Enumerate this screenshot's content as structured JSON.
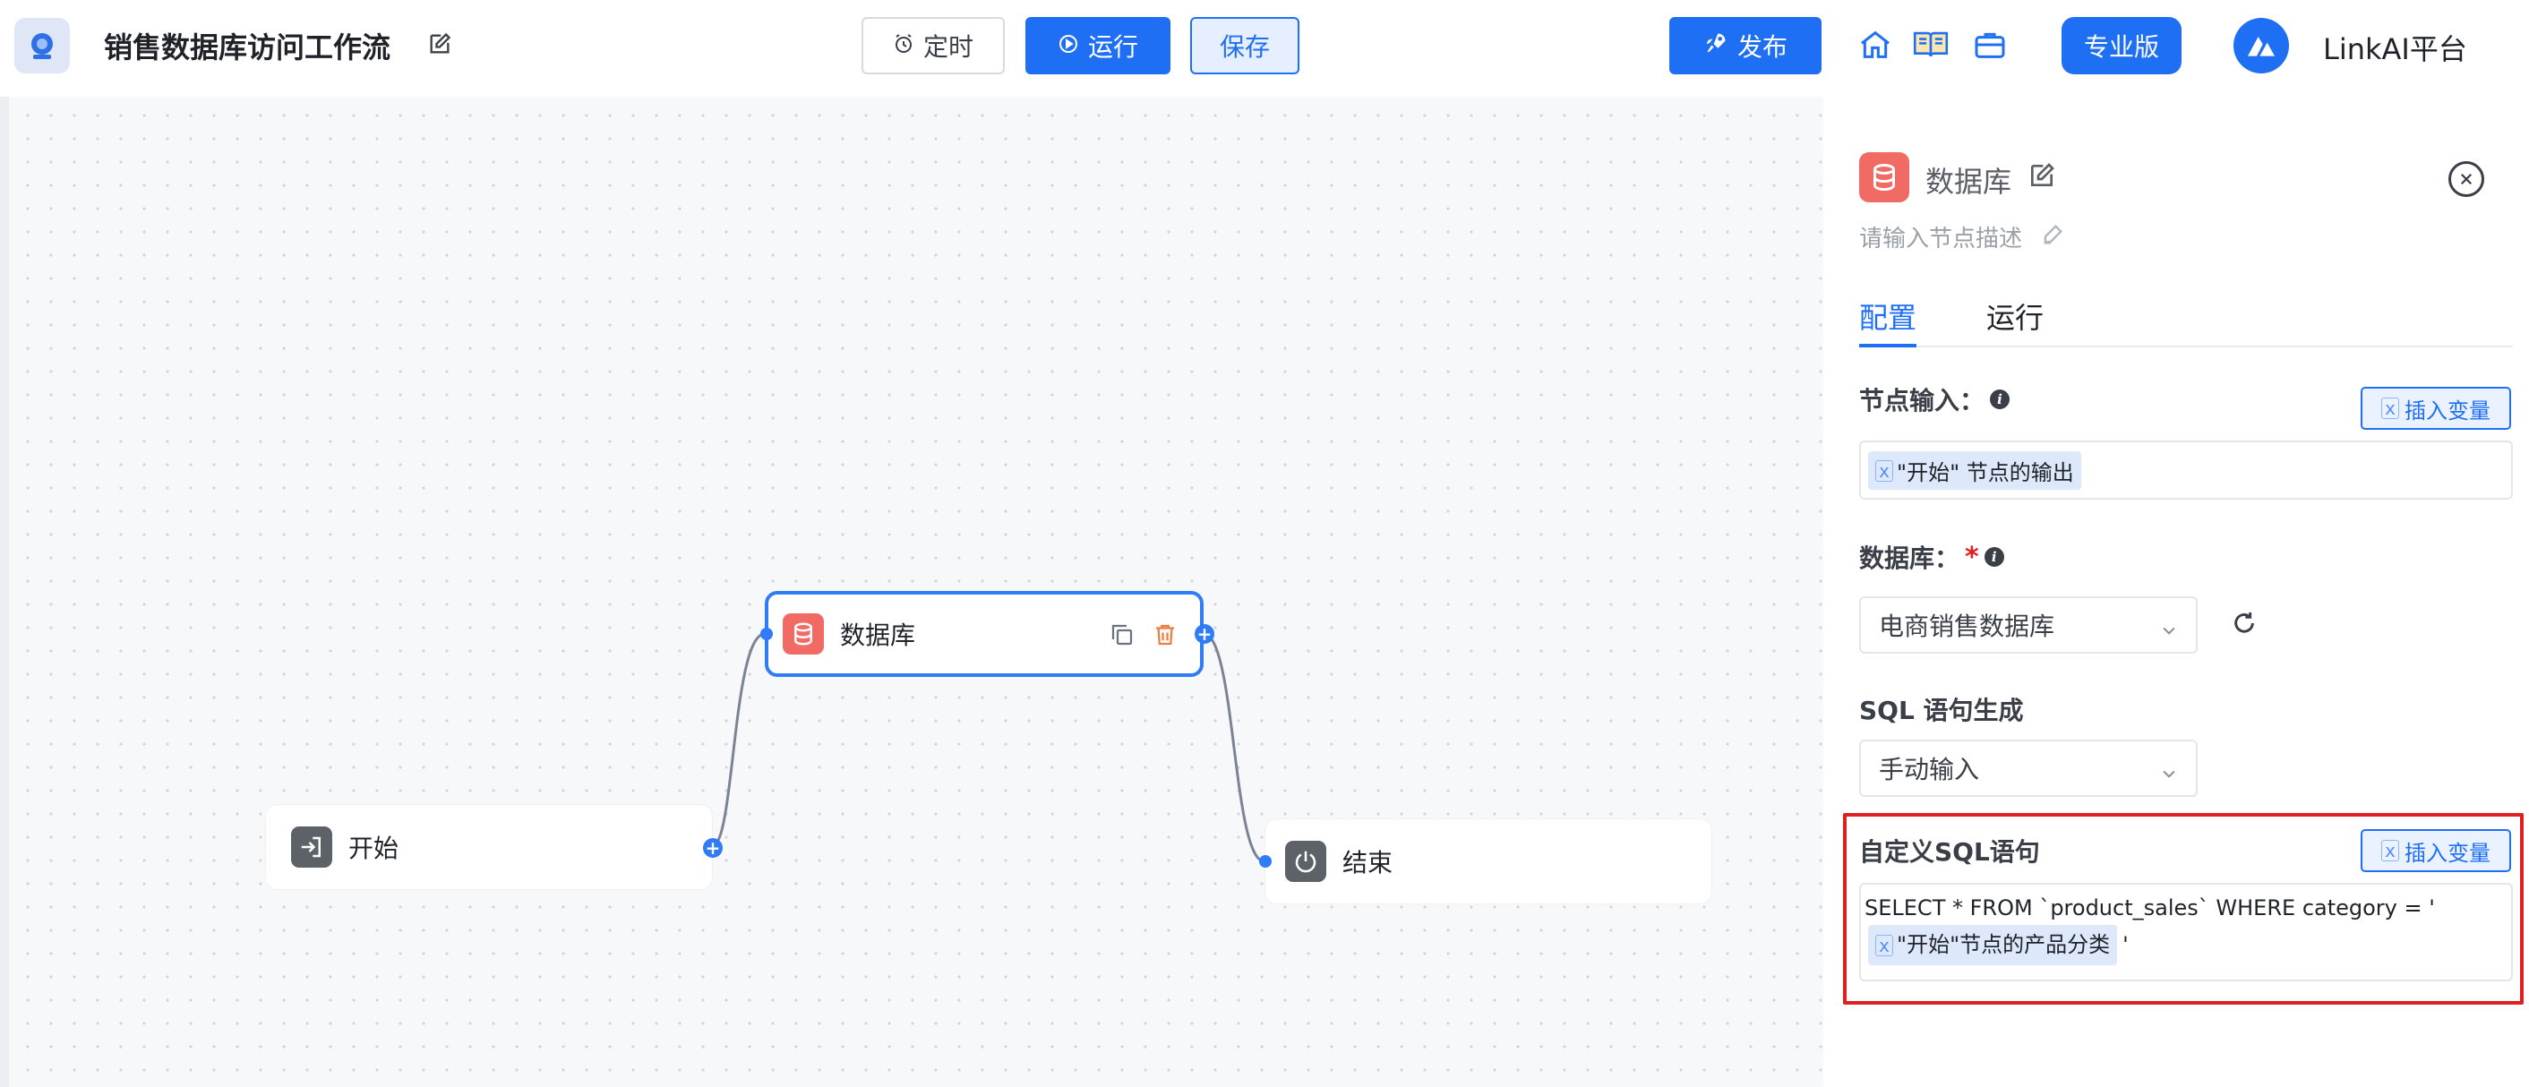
{
  "header": {
    "title": "销售数据库访问工作流",
    "timer_label": "定时",
    "run_label": "运行",
    "save_label": "保存",
    "publish_label": "发布",
    "pro_label": "专业版",
    "platform_name": "LinkAI平台",
    "icons": [
      "home-icon",
      "book-icon",
      "briefcase-icon"
    ]
  },
  "canvas": {
    "nodes": {
      "start": "开始",
      "database": "数据库",
      "end": "结束"
    }
  },
  "panel": {
    "node_title": "数据库",
    "description_placeholder": "请输入节点描述",
    "tabs": [
      "配置",
      "运行"
    ],
    "active_tab": "配置",
    "node_input": {
      "label": "节点输入：",
      "insert_var_label": "插入变量",
      "chip": "\"开始\" 节点的输出"
    },
    "database": {
      "label": "数据库：",
      "required_mark": "*",
      "selected": "电商销售数据库"
    },
    "sql_generation": {
      "label": "SQL 语句生成",
      "selected": "手动输入"
    },
    "custom_sql": {
      "label": "自定义SQL语句",
      "insert_var_label": "插入变量",
      "sql_text": "SELECT * FROM `product_sales` WHERE category = '",
      "chip": "\"开始\"节点的产品分类",
      "sql_suffix": "'"
    }
  },
  "colors": {
    "primary": "#1f6ff5",
    "db_node": "#f16b64",
    "highlight": "#e02020"
  }
}
